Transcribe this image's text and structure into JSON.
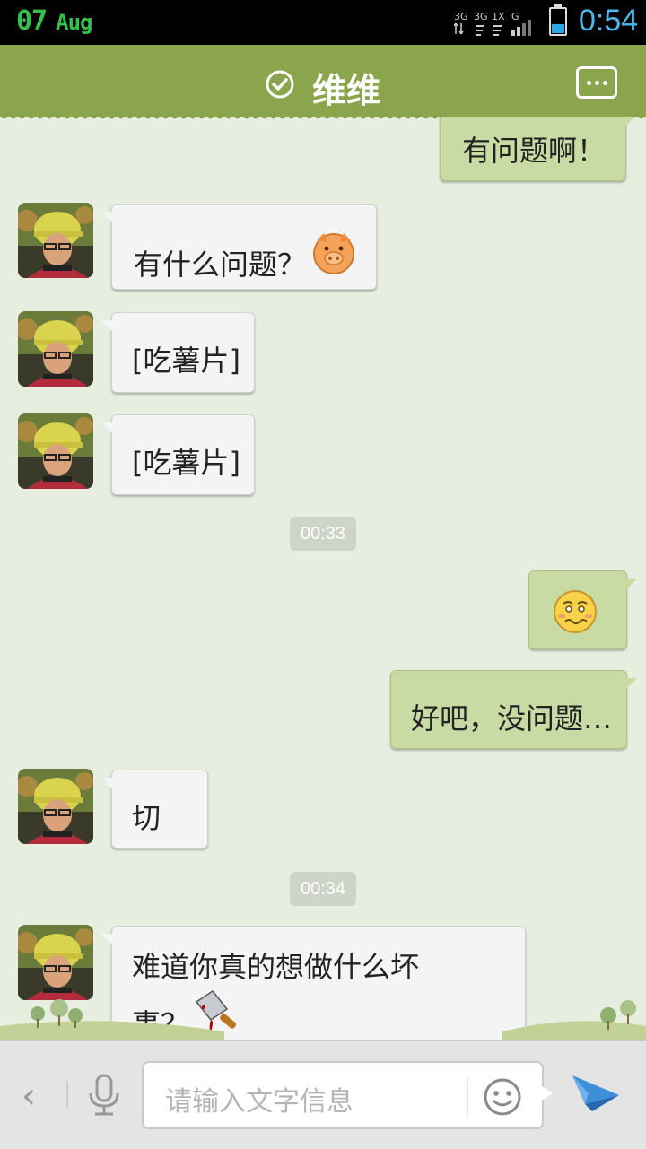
{
  "status_bar": {
    "date_day": "07",
    "date_month": "Aug",
    "network_labels": [
      "3G",
      "3G",
      "1X",
      "G"
    ],
    "time": "0:54",
    "battery_level_percent": 35,
    "accent_green": "#36c24a",
    "accent_blue": "#4db9ea"
  },
  "title_bar": {
    "title": "维维",
    "verified_icon": "check-circle-icon",
    "menu_icon": "more-options-icon",
    "color": "#8aa54c"
  },
  "messages": [
    {
      "side": "right",
      "text": "有问题啊！"
    },
    {
      "side": "left",
      "text": "有什么问题？",
      "emoji": "pig-face-emoji"
    },
    {
      "side": "left",
      "text": "[吃薯片]"
    },
    {
      "side": "left",
      "text": "[吃薯片]"
    },
    {
      "type": "time",
      "text": "00:33"
    },
    {
      "side": "right",
      "text": "",
      "emoji": "embarrassed-face-emoji"
    },
    {
      "side": "right",
      "text": "好吧，没问题…"
    },
    {
      "side": "left",
      "text": "切"
    },
    {
      "type": "time",
      "text": "00:34"
    },
    {
      "side": "left",
      "text_line1": "难道你真的想做什么坏",
      "text_line2": "事？",
      "emoji": "bloody-cleaver-emoji"
    }
  ],
  "input_bar": {
    "placeholder": "请输入文字信息",
    "back_icon": "chevron-left-icon",
    "voice_icon": "microphone-icon",
    "emoji_icon": "smiley-icon",
    "send_icon": "paper-plane-send-icon"
  }
}
